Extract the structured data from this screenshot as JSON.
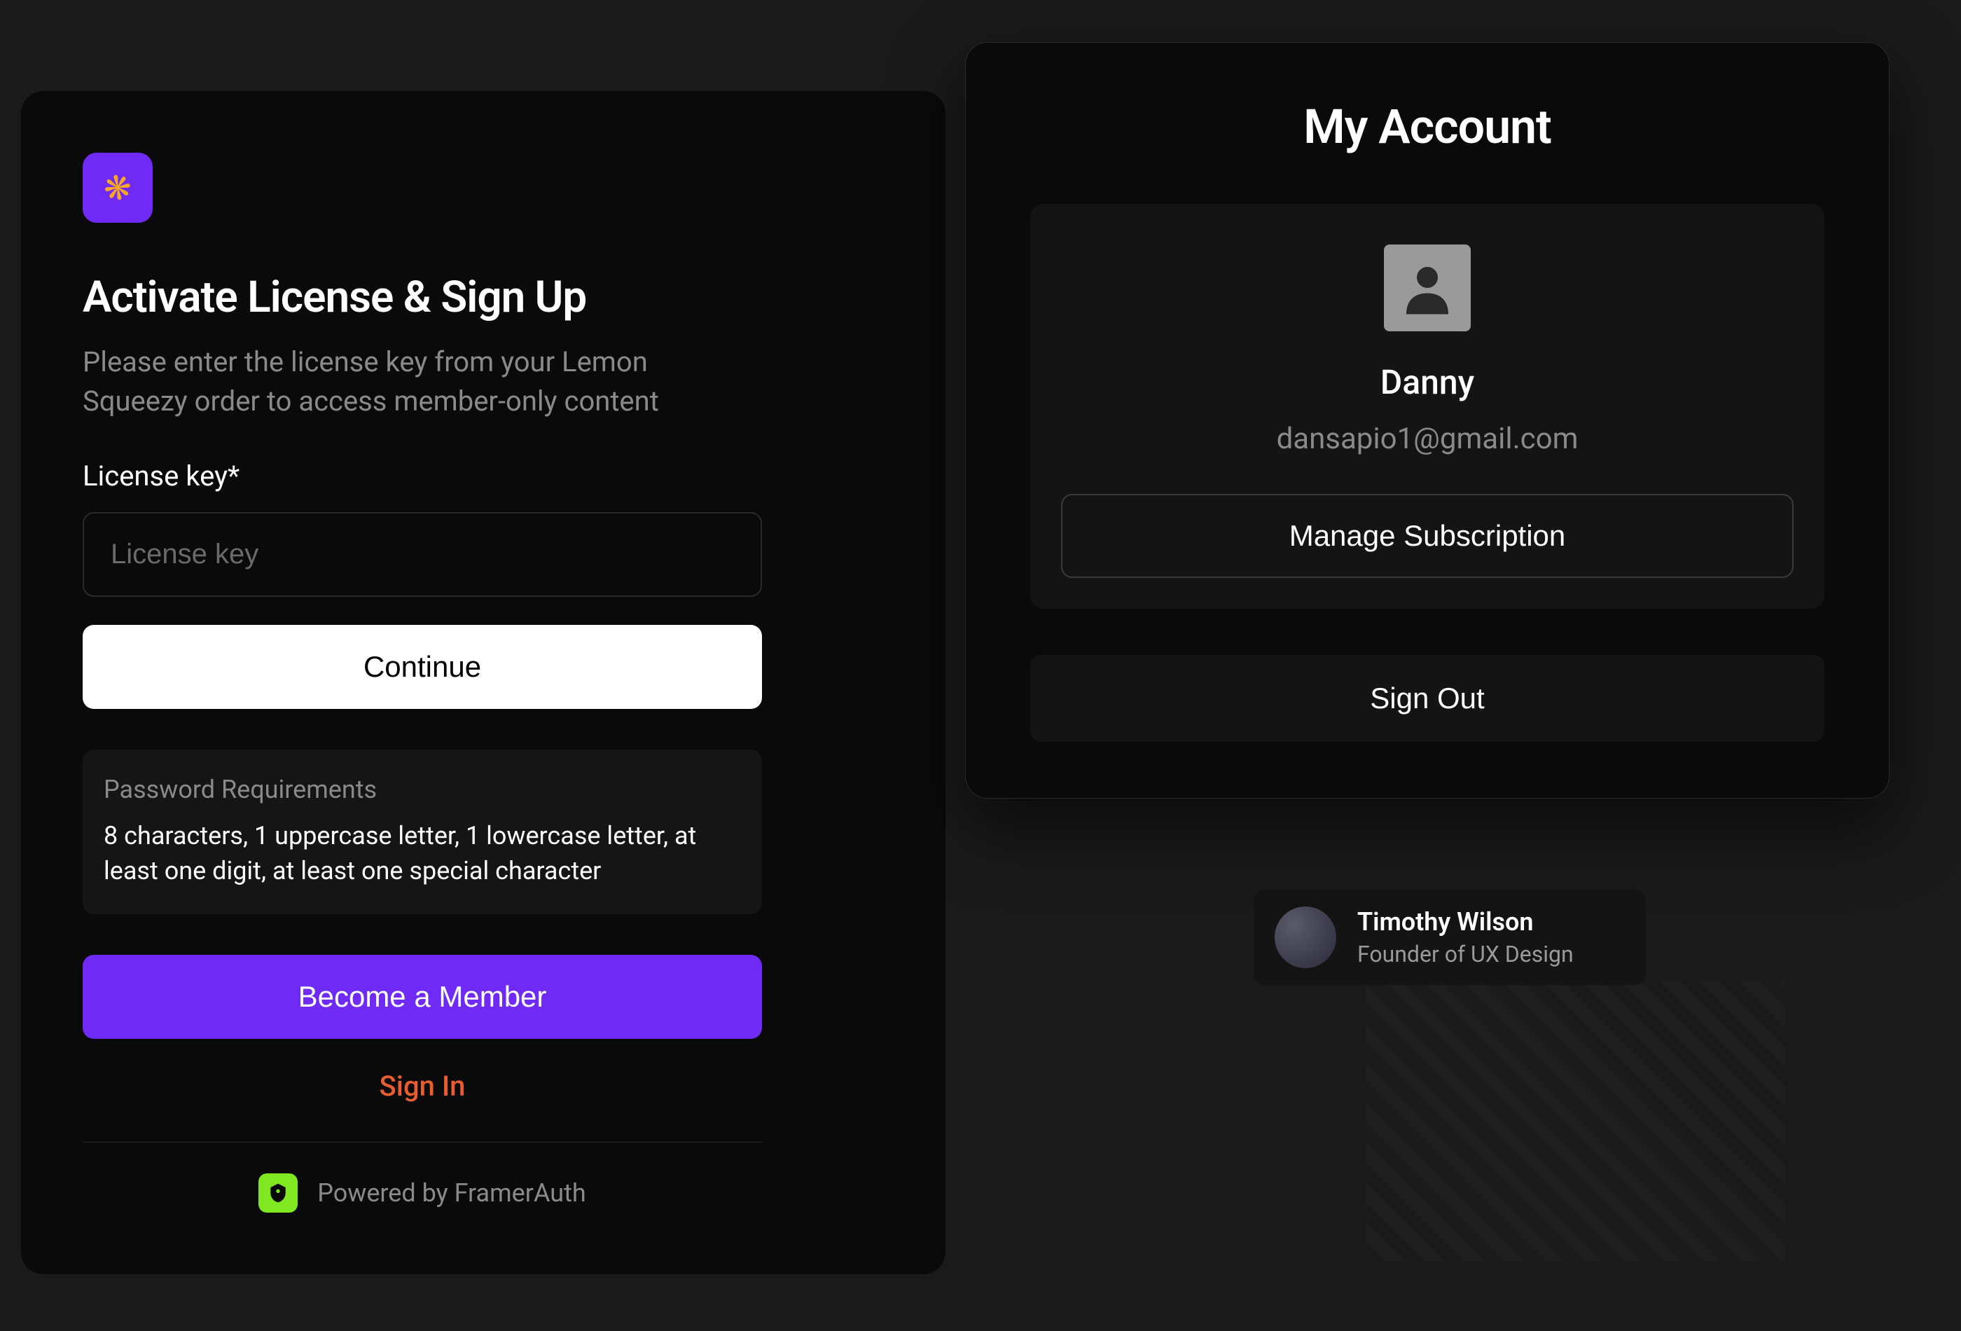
{
  "signup": {
    "title": "Activate License & Sign Up",
    "subtitle": "Please enter the license key from your Lemon Squeezy order to access member-only content",
    "license_label": "License key*",
    "license_placeholder": "License key",
    "continue_label": "Continue",
    "requirements": {
      "title": "Password Requirements",
      "text": "8 characters, 1 uppercase letter, 1 lowercase letter, at least one digit, at least one special character"
    },
    "member_button": "Become a Member",
    "signin_link": "Sign In",
    "powered_by": "Powered by FramerAuth"
  },
  "account": {
    "title": "My Account",
    "name": "Danny",
    "email": "dansapio1@gmail.com",
    "manage_label": "Manage Subscription",
    "signout_label": "Sign Out"
  },
  "peek_user": {
    "name": "Timothy Wilson",
    "role": "Founder of UX Design"
  },
  "colors": {
    "accent_purple": "#6F2BF5",
    "accent_orange": "#E85D2F",
    "badge_green": "#7FE821"
  }
}
